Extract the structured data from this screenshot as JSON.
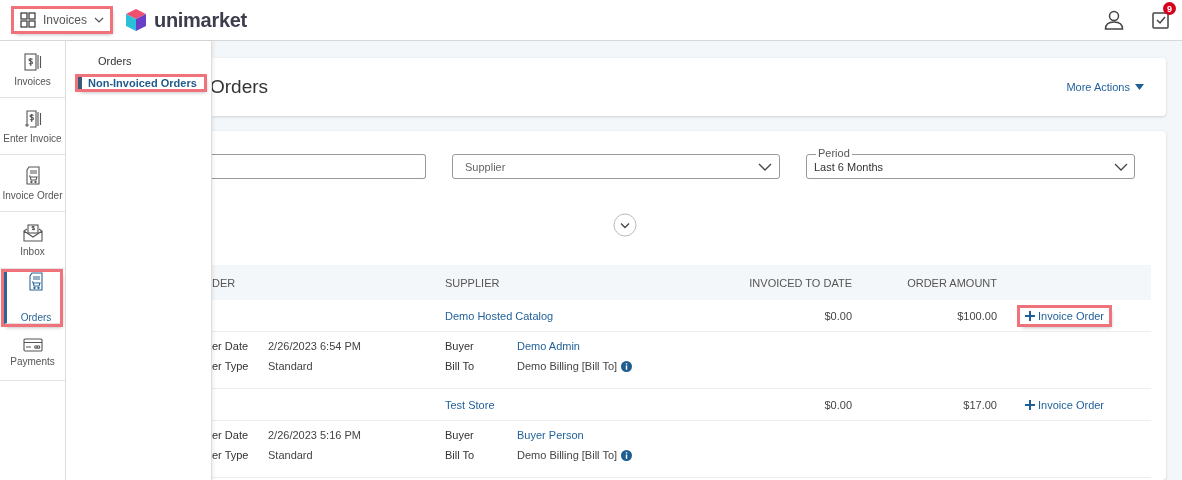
{
  "top_bar": {
    "app_menu": {
      "label": "Invoices",
      "highlighted": true
    },
    "logo": "unimarket",
    "notifications_badge": "9"
  },
  "rail": [
    {
      "label": "Invoices",
      "selected": false,
      "highlighted": false
    },
    {
      "label": "Enter Invoice",
      "selected": false,
      "highlighted": false
    },
    {
      "label": "Invoice Order",
      "selected": false,
      "highlighted": false
    },
    {
      "label": "Inbox",
      "selected": false,
      "highlighted": false
    },
    {
      "label": "Orders",
      "selected": true,
      "highlighted": true
    },
    {
      "label": "Payments",
      "selected": false,
      "highlighted": false
    }
  ],
  "flyout": [
    {
      "label": "Orders",
      "selected": false,
      "highlighted": false
    },
    {
      "label": "Non-Invoiced Orders",
      "selected": true,
      "highlighted": true
    }
  ],
  "page_title": "Orders",
  "more_actions": "More Actions",
  "filters": {
    "supplier": {
      "placeholder": "Supplier"
    },
    "period": {
      "label": "Period",
      "value": "Last 6 Months"
    }
  },
  "table": {
    "columns": [
      "DER",
      "SUPPLIER",
      "INVOICED TO DATE",
      "ORDER AMOUNT"
    ],
    "rows": [
      {
        "supplier": "Demo Hosted Catalog",
        "invoiced": "$0.00",
        "amount": "$100.00",
        "action": {
          "label": "Invoice Order",
          "highlighted": true
        },
        "details": [
          {
            "label": "er Date",
            "value": "2/26/2023 6:54 PM"
          },
          {
            "label": "er Type",
            "value": "Standard"
          }
        ],
        "parties": [
          {
            "label": "Buyer",
            "value": "Demo Admin",
            "info": false
          },
          {
            "label": "Bill To",
            "value": "Demo Billing [Bill To]",
            "info": true
          }
        ]
      },
      {
        "supplier": "Test Store",
        "invoiced": "$0.00",
        "amount": "$17.00",
        "action": {
          "label": "Invoice Order",
          "highlighted": false
        },
        "details": [
          {
            "label": "er Date",
            "value": "2/26/2023 5:16 PM"
          },
          {
            "label": "er Type",
            "value": "Standard"
          }
        ],
        "parties": [
          {
            "label": "Buyer",
            "value": "Buyer Person",
            "info": false
          },
          {
            "label": "Bill To",
            "value": "Demo Billing [Bill To]",
            "info": true
          }
        ]
      }
    ]
  }
}
